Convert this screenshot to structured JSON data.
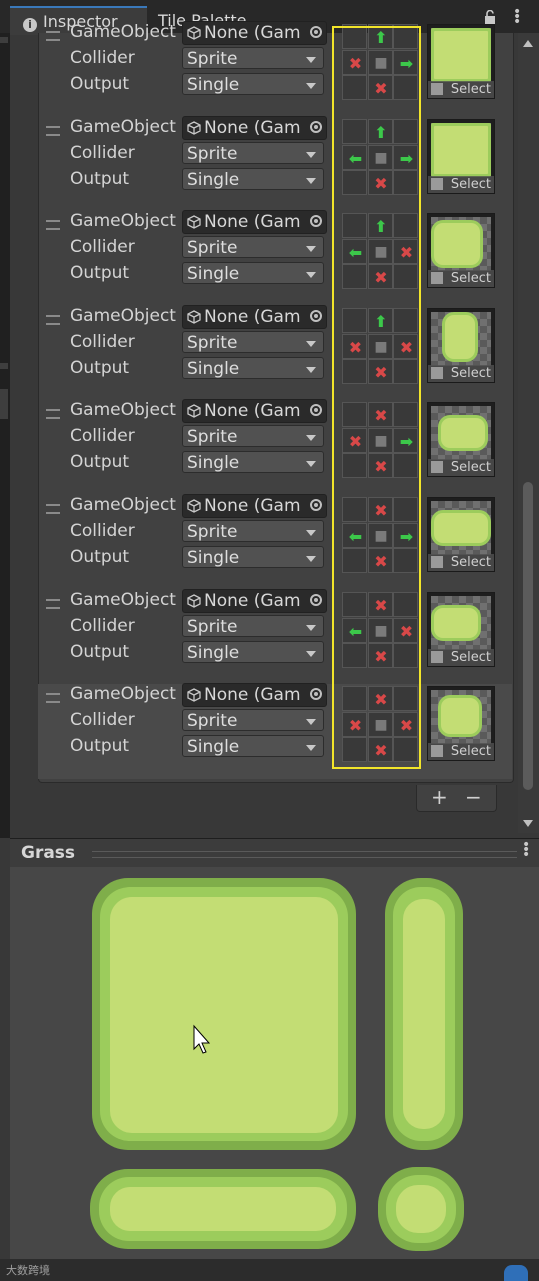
{
  "tabs": [
    {
      "label": "Inspector",
      "active": true
    },
    {
      "label": "Tile Palette",
      "active": false
    }
  ],
  "labels": {
    "gameobject": "GameObject",
    "collider": "Collider",
    "output": "Output"
  },
  "field_none_text": "None (Gam",
  "select_label": "Select",
  "rules": [
    {
      "gameobject": "None (Gam",
      "collider": "Sprite",
      "output": "Single",
      "neighbors": [
        "",
        "up",
        "",
        "x",
        "center",
        "right",
        "",
        "x",
        ""
      ],
      "sprite": "square-tile"
    },
    {
      "gameobject": "None (Gam",
      "collider": "Sprite",
      "output": "Single",
      "neighbors": [
        "",
        "up",
        "",
        "left",
        "center",
        "right",
        "",
        "x",
        ""
      ],
      "sprite": "square-tile"
    },
    {
      "gameobject": "None (Gam",
      "collider": "Sprite",
      "output": "Single",
      "neighbors": [
        "",
        "up",
        "",
        "left",
        "center",
        "x",
        "",
        "x",
        ""
      ],
      "sprite": "edge-right-tile"
    },
    {
      "gameobject": "None (Gam",
      "collider": "Sprite",
      "output": "Single",
      "neighbors": [
        "",
        "up",
        "",
        "x",
        "center",
        "x",
        "",
        "x",
        ""
      ],
      "sprite": "vertical-cap-tile"
    },
    {
      "gameobject": "None (Gam",
      "collider": "Sprite",
      "output": "Single",
      "neighbors": [
        "",
        "x",
        "",
        "x",
        "center",
        "right",
        "",
        "x",
        ""
      ],
      "sprite": "left-cap-tile"
    },
    {
      "gameobject": "None (Gam",
      "collider": "Sprite",
      "output": "Single",
      "neighbors": [
        "",
        "x",
        "",
        "left",
        "center",
        "right",
        "",
        "x",
        ""
      ],
      "sprite": "horizontal-tile"
    },
    {
      "gameobject": "None (Gam",
      "collider": "Sprite",
      "output": "Single",
      "neighbors": [
        "",
        "x",
        "",
        "left",
        "center",
        "x",
        "",
        "x",
        ""
      ],
      "sprite": "right-cap-tile"
    },
    {
      "gameobject": "None (Gam",
      "collider": "Sprite",
      "output": "Single",
      "neighbors": [
        "",
        "x",
        "",
        "x",
        "center",
        "x",
        "",
        "x",
        ""
      ],
      "sprite": "single-tile"
    }
  ],
  "list_buttons": {
    "add": "+",
    "remove": "−"
  },
  "grass_panel": {
    "title": "Grass"
  },
  "watermark": "大数跨境",
  "colors": {
    "grass_dark": "#7fae4a",
    "grass_mid": "#9ccc5c",
    "grass_light": "#c3dd74",
    "highlight_box": "#f2e52a",
    "arrow_green": "#3cc84a",
    "x_red": "#d84848"
  }
}
